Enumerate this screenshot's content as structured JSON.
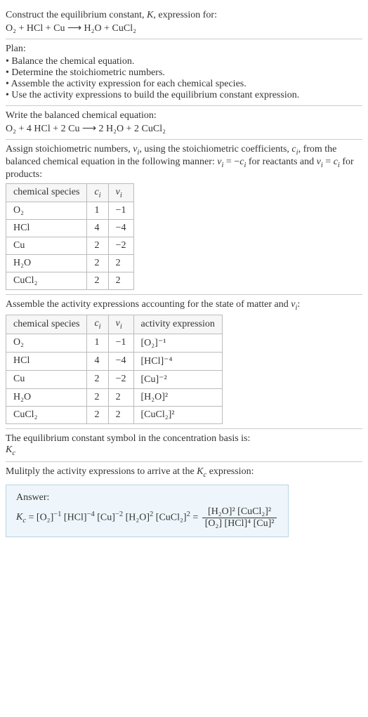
{
  "intro": {
    "line1": "Construct the equilibrium constant, K, expression for:",
    "equation": "O₂ + HCl + Cu ⟶ H₂O + CuCl₂"
  },
  "plan": {
    "title": "Plan:",
    "items": [
      "• Balance the chemical equation.",
      "• Determine the stoichiometric numbers.",
      "• Assemble the activity expression for each chemical species.",
      "• Use the activity expressions to build the equilibrium constant expression."
    ]
  },
  "balanced": {
    "title": "Write the balanced chemical equation:",
    "equation": "O₂ + 4 HCl + 2 Cu ⟶ 2 H₂O + 2 CuCl₂"
  },
  "assign": {
    "text": "Assign stoichiometric numbers, νᵢ, using the stoichiometric coefficients, cᵢ, from the balanced chemical equation in the following manner: νᵢ = −cᵢ for reactants and νᵢ = cᵢ for products:",
    "headers": [
      "chemical species",
      "cᵢ",
      "νᵢ"
    ],
    "rows": [
      [
        "O₂",
        "1",
        "−1"
      ],
      [
        "HCl",
        "4",
        "−4"
      ],
      [
        "Cu",
        "2",
        "−2"
      ],
      [
        "H₂O",
        "2",
        "2"
      ],
      [
        "CuCl₂",
        "2",
        "2"
      ]
    ]
  },
  "assemble": {
    "title": "Assemble the activity expressions accounting for the state of matter and νᵢ:",
    "headers": [
      "chemical species",
      "cᵢ",
      "νᵢ",
      "activity expression"
    ],
    "rows": [
      [
        "O₂",
        "1",
        "−1",
        "[O₂]⁻¹"
      ],
      [
        "HCl",
        "4",
        "−4",
        "[HCl]⁻⁴"
      ],
      [
        "Cu",
        "2",
        "−2",
        "[Cu]⁻²"
      ],
      [
        "H₂O",
        "2",
        "2",
        "[H₂O]²"
      ],
      [
        "CuCl₂",
        "2",
        "2",
        "[CuCl₂]²"
      ]
    ]
  },
  "symbol": {
    "line1": "The equilibrium constant symbol in the concentration basis is:",
    "kc": "K꜀"
  },
  "multiply": {
    "title": "Mulitply the activity expressions to arrive at the K꜀ expression:"
  },
  "answer": {
    "label": "Answer:",
    "lhs": "K꜀ = [O₂]⁻¹ [HCl]⁻⁴ [Cu]⁻² [H₂O]² [CuCl₂]² = ",
    "num": "[H₂O]² [CuCl₂]²",
    "den": "[O₂] [HCl]⁴ [Cu]²"
  }
}
